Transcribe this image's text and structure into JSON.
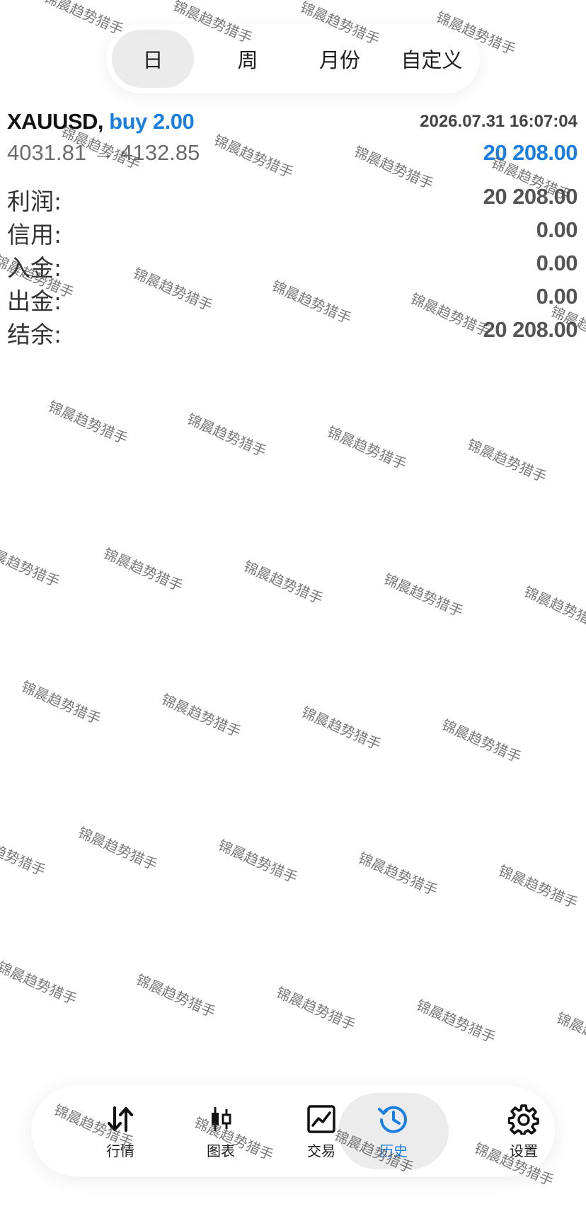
{
  "periods": {
    "items": [
      "日",
      "周",
      "月份",
      "自定义"
    ],
    "selected": "日"
  },
  "trade": {
    "symbol": "XAUUSD,",
    "side_volume": "buy 2.00",
    "datetime": "2026.07.31 16:07:04",
    "prices": "4031.81 → 4132.85",
    "profit": "20 208.00"
  },
  "summary": [
    {
      "label": "利润:",
      "value": "20 208.00"
    },
    {
      "label": "信用:",
      "value": "0.00"
    },
    {
      "label": "入金:",
      "value": "0.00"
    },
    {
      "label": "出金:",
      "value": "0.00"
    },
    {
      "label": "结余:",
      "value": "20 208.00"
    }
  ],
  "watermark": "锦晨趋势猎手",
  "bottom_nav": {
    "items": [
      {
        "label": "行情",
        "icon": "quotes-arrows-icon"
      },
      {
        "label": "图表",
        "icon": "candlestick-chart-icon"
      },
      {
        "label": "交易",
        "icon": "trade-chart-icon"
      },
      {
        "label": "历史",
        "icon": "history-clock-icon"
      },
      {
        "label": "设置",
        "icon": "gear-icon"
      }
    ],
    "active": "历史"
  },
  "colors": {
    "accent": "#1a7fe0",
    "text": "#1c1c1e",
    "muted": "#555555",
    "active_bg": "#ebebeb"
  }
}
